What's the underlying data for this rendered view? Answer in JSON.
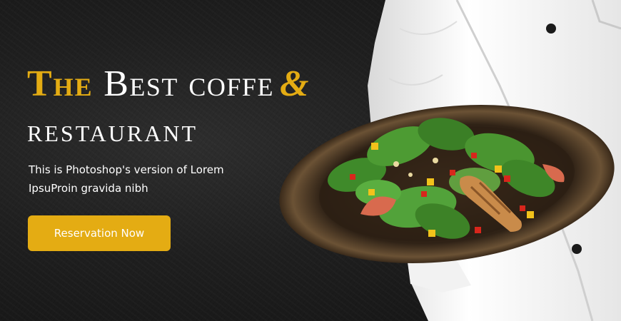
{
  "hero": {
    "title_accent": "The",
    "title_rest": " Best coffe",
    "title_amp": "&",
    "title_line2": "restaurant",
    "subtitle": "This is Photoshop's version  of Lorem IpsuProin gravida nibh",
    "cta_label": "Reservation Now"
  },
  "colors": {
    "accent": "#e4ac13",
    "background": "#1b1b1b",
    "text": "#ffffff"
  }
}
